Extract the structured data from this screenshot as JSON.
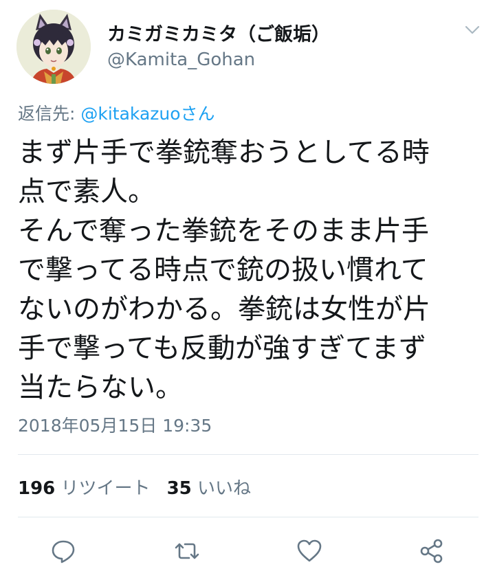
{
  "author": {
    "display_name": "カミガミカミタ（ご飯垢）",
    "handle": "@Kamita_Gohan"
  },
  "reply": {
    "prefix": "返信先: ",
    "mention": "@kitakazuoさん"
  },
  "tweet": {
    "lines": [
      "まず片手で拳銃奪おうとしてる時",
      "点で素人。",
      "そんで奪った拳銃をそのまま片手",
      "で撃ってる時点で銃の扱い慣れて",
      "ないのがわかる。拳銃は女性が片",
      "手で撃っても反動が強すぎてまず",
      "当たらない。"
    ],
    "timestamp": "2018年05月15日 19:35"
  },
  "stats": {
    "retweet_count": "196",
    "retweet_label": "リツイート",
    "like_count": "35",
    "like_label": "いいね"
  },
  "actions": {
    "icons": [
      "reply-icon",
      "retweet-icon",
      "like-icon",
      "share-icon"
    ],
    "icon_color": "#657786"
  },
  "colors": {
    "link": "#1da1f2",
    "secondary_text": "#657786",
    "primary_text": "#14171a",
    "divider": "#e1e8ed"
  }
}
